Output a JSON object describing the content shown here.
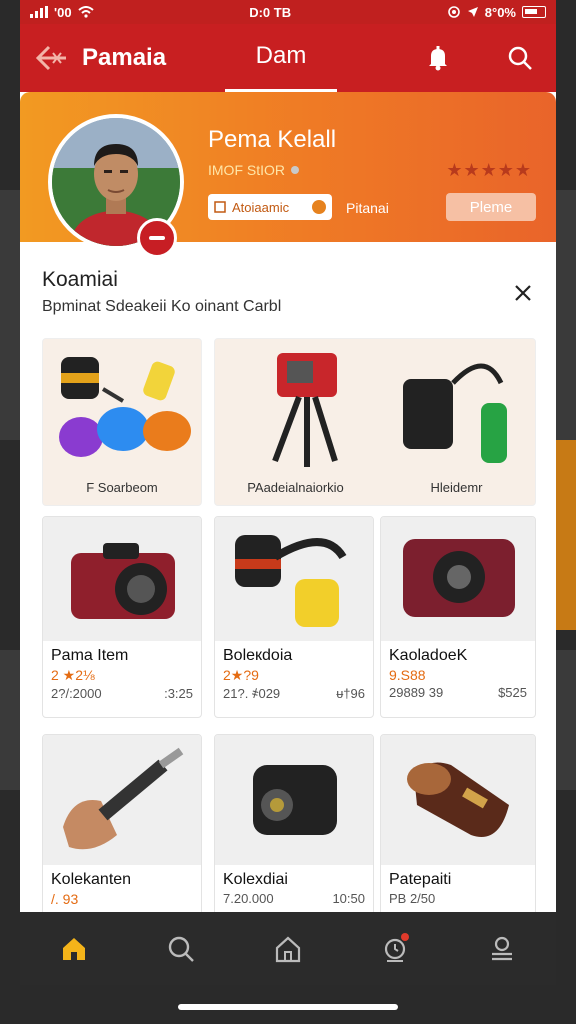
{
  "status": {
    "carrier": "'00",
    "time": "D:0 TB",
    "battery_text": "8°0%"
  },
  "appbar": {
    "brand": "Pamaia",
    "tab": "Dam"
  },
  "profile": {
    "name": "Pema Kelall",
    "subtitle": "IMOF StIOR",
    "rating": "★★★★★",
    "pill": "Atoiaamic",
    "link": "Pitanai",
    "button": "Pleme"
  },
  "section": {
    "title": "Koamiai",
    "subtitle": "Bpminat Sdeakeii Ko oinant Carbl"
  },
  "banners": [
    {
      "label": "F Soarbeom"
    },
    {
      "label": "PAadeialnaiorkio"
    },
    {
      "label": "Hleidemr"
    }
  ],
  "products": [
    {
      "name": "Pama Item",
      "price": "2 ★2⅛",
      "meta_left": "2?/:2000",
      "meta_right": ":3:25"
    },
    {
      "name": "Boleкdoia",
      "price": "2★?9",
      "meta_left": "21?. ҂029",
      "meta_right": "ᵾ†96"
    },
    {
      "name": "KaoladoeK",
      "price": "9.S88",
      "meta_left": "29889 39",
      "meta_right": "$525"
    },
    {
      "name": "Kolekanten",
      "price": "/. 93",
      "meta_left": "",
      "meta_right": ""
    },
    {
      "name": "Kolexdiai",
      "price": "",
      "meta_left": "7.20.000",
      "meta_right": "10:50"
    },
    {
      "name": "Patepaiti",
      "price": "",
      "meta_left": "PB 2/50",
      "meta_right": ""
    }
  ]
}
